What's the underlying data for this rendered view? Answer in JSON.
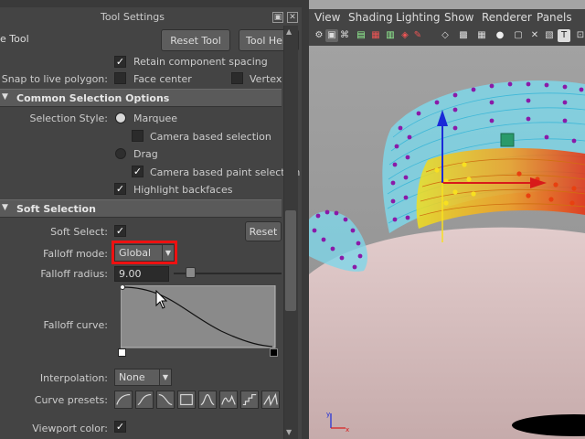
{
  "panel": {
    "title": "Tool Settings",
    "tool_name": "e Tool",
    "reset_tool": "Reset Tool",
    "tool_help": "Tool Help",
    "retain_spacing": "Retain component spacing",
    "snap_label": "Snap to live polygon:",
    "face_center": "Face center",
    "vertex": "Vertex"
  },
  "common": {
    "title": "Common Selection Options",
    "selection_style_label": "Selection Style:",
    "marquee": "Marquee",
    "camera_based_selection": "Camera based selection",
    "drag": "Drag",
    "camera_based_paint": "Camera based paint selection",
    "highlight_backfaces": "Highlight backfaces"
  },
  "soft": {
    "title": "Soft Selection",
    "soft_select_label": "Soft Select:",
    "reset": "Reset",
    "falloff_mode_label": "Falloff mode:",
    "falloff_mode_value": "Global",
    "falloff_radius_label": "Falloff radius:",
    "falloff_radius_value": "9.00",
    "falloff_curve_label": "Falloff curve:",
    "interpolation_label": "Interpolation:",
    "interpolation_value": "None",
    "curve_presets_label": "Curve presets:",
    "viewport_color_label": "Viewport color:"
  },
  "viewport": {
    "menus": [
      "View",
      "Shading",
      "Lighting",
      "Show",
      "Renderer",
      "Panels"
    ]
  },
  "colors": {
    "highlight_red": "#ee1111",
    "section_bg": "#5a5a5a",
    "panel_bg": "#444444"
  }
}
